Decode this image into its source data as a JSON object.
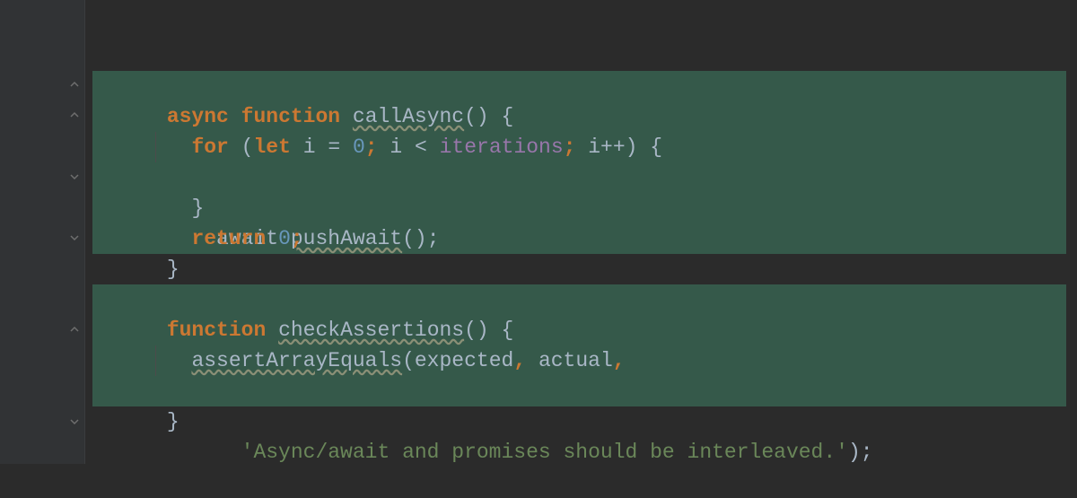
{
  "code": {
    "line1": {
      "async": "async",
      "function": "function",
      "fnName": "callAsync",
      "tail": "() {"
    },
    "line2": {
      "for": "for",
      "open": " (",
      "let": "let",
      "varDecl": " i ",
      "eq": "=",
      "space1": " ",
      "zero": "0",
      "semi1": ";",
      "cond": " i ",
      "lt": "<",
      "space2": " ",
      "iterations": "iterations",
      "semi2": ";",
      "inc": " i++) {"
    },
    "line3": {
      "await": "await",
      "space": " ",
      "call": "pushAwait",
      "tail": "();"
    },
    "line4": {
      "brace": "}"
    },
    "line5": {
      "return": "return",
      "space": " ",
      "zero": "0",
      "semi": ";"
    },
    "line6": {
      "brace": "}"
    },
    "line8": {
      "function": "function",
      "fnName": "checkAssertions",
      "tail": "() {"
    },
    "line9": {
      "call": "assertArrayEquals",
      "open": "(expected",
      "comma1": ",",
      "space1": " ",
      "actual": "actual",
      "comma2": ","
    },
    "line10": {
      "str": "'Async/await and promises should be interleaved.'",
      "tail": ");"
    },
    "line11": {
      "brace": "}"
    }
  },
  "colors": {
    "bg": "#2b2b2b",
    "gutter": "#313335",
    "highlight": "#35594a",
    "keywordOrange": "#cc7832",
    "text": "#a9b7c6",
    "number": "#6897bb",
    "string": "#6a8759",
    "purple": "#9876aa"
  }
}
